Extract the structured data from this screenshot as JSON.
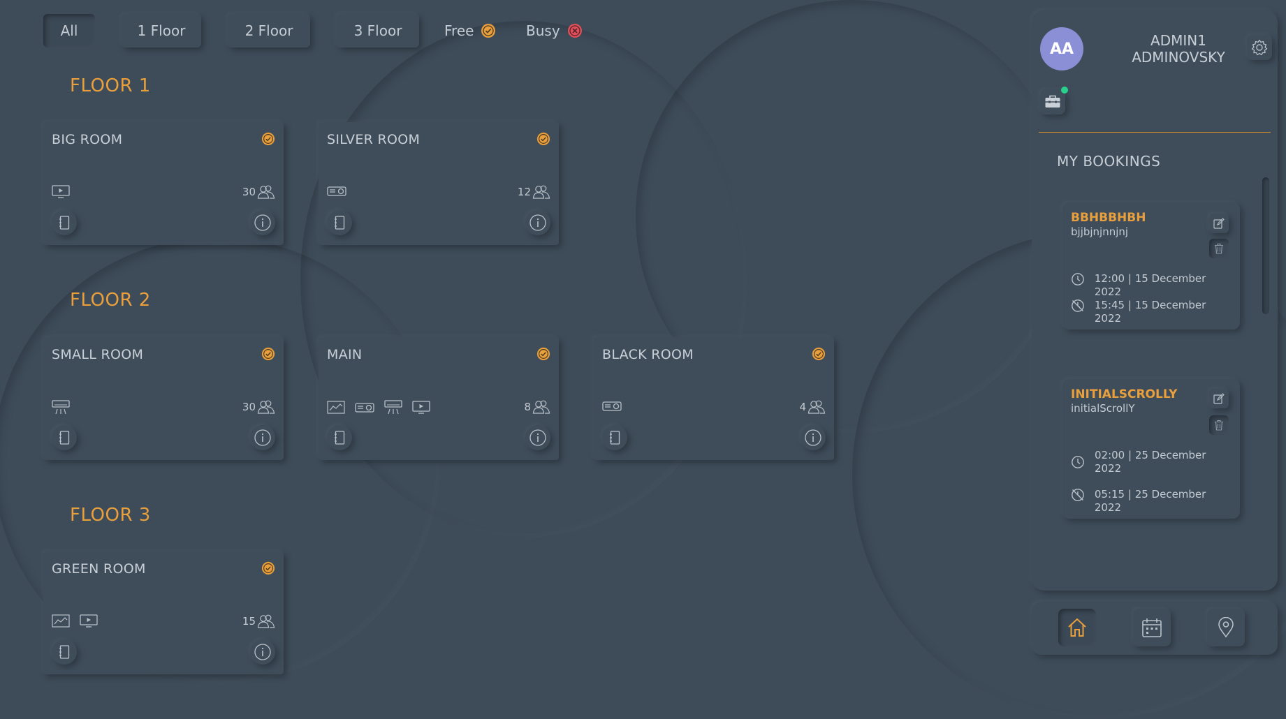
{
  "filters": {
    "items": [
      "All",
      "1 Floor",
      "2 Floor",
      "3 Floor"
    ],
    "active": "All",
    "legend_free": "Free",
    "legend_busy": "Busy"
  },
  "floors": [
    {
      "title": "FLOOR 1",
      "rooms": [
        {
          "name": "BIG ROOM",
          "status": "free",
          "capacity": "30",
          "features": [
            "tv-icon"
          ]
        },
        {
          "name": "SILVER ROOM",
          "status": "free",
          "capacity": "12",
          "features": [
            "projector-icon"
          ]
        }
      ]
    },
    {
      "title": "FLOOR 2",
      "rooms": [
        {
          "name": "SMALL ROOM",
          "status": "free",
          "capacity": "30",
          "features": [
            "air-conditioner-icon"
          ]
        },
        {
          "name": "MAIN",
          "status": "free",
          "capacity": "8",
          "features": [
            "whiteboard-icon",
            "projector-icon",
            "air-conditioner-icon",
            "tv-icon"
          ]
        },
        {
          "name": "BLACK ROOM",
          "status": "free",
          "capacity": "4",
          "features": [
            "projector-icon"
          ]
        }
      ]
    },
    {
      "title": "FLOOR 3",
      "rooms": [
        {
          "name": "GREEN ROOM",
          "status": "free",
          "capacity": "15",
          "features": [
            "whiteboard-icon",
            "tv-icon"
          ]
        }
      ]
    }
  ],
  "user": {
    "initials": "AA",
    "name_line1": "ADMIN1",
    "name_line2": "ADMINOVSKY",
    "online": true
  },
  "bookings": {
    "title": "MY BOOKINGS",
    "items": [
      {
        "title": "BBHBBHBH",
        "description": "bjjbjnjnnjnj",
        "start": "12:00 | 15 December 2022",
        "end": "15:45 | 15 December 2022"
      },
      {
        "title": "INITIALSCROLLY",
        "description": "initialScrollY",
        "start": "02:00 | 25 December 2022",
        "end": "05:15 | 25 December 2022"
      }
    ]
  },
  "nav": {
    "items": [
      "home-icon",
      "calendar-icon",
      "location-icon"
    ],
    "active": "home-icon"
  },
  "colors": {
    "accent": "#e89f3c",
    "background": "#3e4c5a",
    "free": "#e89f3c",
    "busy": "#e0505a",
    "avatar": "#8b8fd6",
    "online": "#27d08c"
  }
}
